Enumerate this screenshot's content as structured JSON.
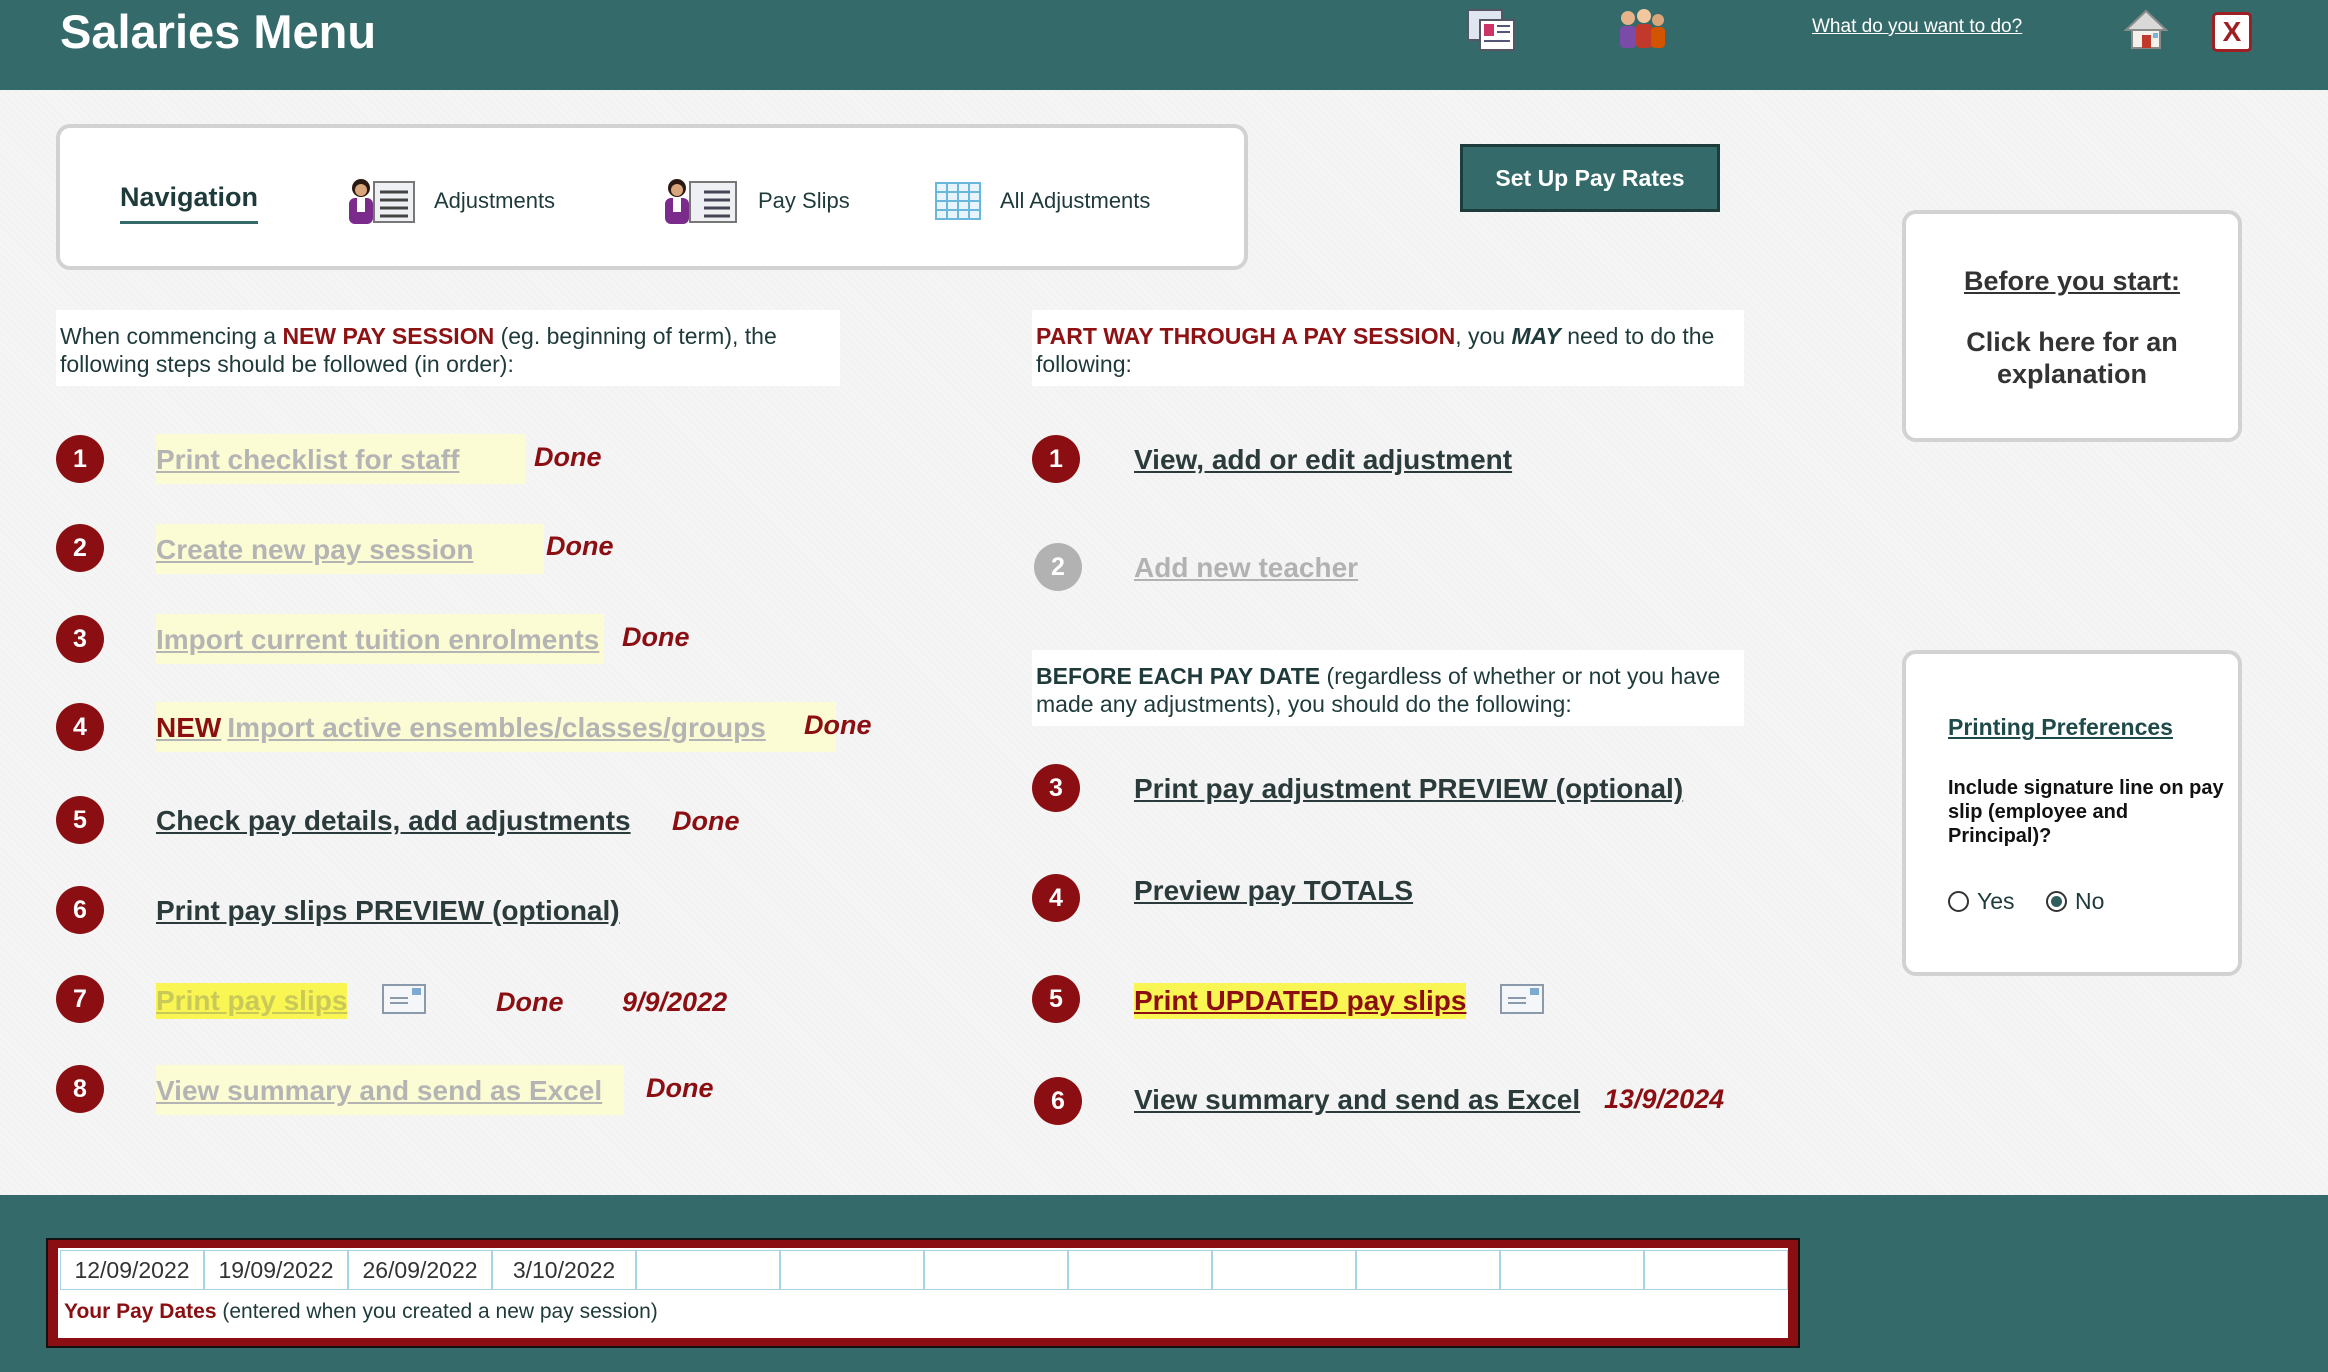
{
  "header": {
    "title": "Salaries Menu",
    "help_link": "What do you want to do?",
    "close_label": "X",
    "icons": [
      "documents-icon",
      "people-icon",
      "home-icon",
      "close-icon"
    ]
  },
  "navigation": {
    "title": "Navigation",
    "items": [
      {
        "label": "Adjustments",
        "icon": "person-list-icon"
      },
      {
        "label": "Pay Slips",
        "icon": "person-list-icon"
      },
      {
        "label": "All Adjustments",
        "icon": "grid-icon"
      }
    ]
  },
  "setup_button": "Set Up Pay Rates",
  "left_intro": {
    "part1": "When commencing a ",
    "bold": "NEW PAY SESSION",
    "part2": " (eg. beginning of term), the following steps should be followed (in order):"
  },
  "left_steps": [
    {
      "num": "1",
      "label": "Print checklist for staff",
      "status": "Done",
      "date": ""
    },
    {
      "num": "2",
      "label": "Create new pay session",
      "status": "Done",
      "date": ""
    },
    {
      "num": "3",
      "label": "Import current tuition enrolments",
      "status": "Done",
      "date": ""
    },
    {
      "num": "4",
      "new_tag": "NEW",
      "label": "Import active ensembles/classes/groups",
      "status": "Done",
      "date": ""
    },
    {
      "num": "5",
      "label": "Check pay details, add adjustments",
      "status": "Done",
      "date": ""
    },
    {
      "num": "6",
      "label": "Print pay slips PREVIEW (optional)",
      "status": "",
      "date": ""
    },
    {
      "num": "7",
      "label": "Print pay slips",
      "status": "Done",
      "date": "9/9/2022"
    },
    {
      "num": "8",
      "label": "View summary and send as Excel",
      "status": "Done",
      "date": ""
    }
  ],
  "right_intro": {
    "bold": "PART WAY THROUGH A PAY SESSION",
    "part1": ", you ",
    "may": "MAY",
    "part2": " need to do the following:"
  },
  "right_steps_a": [
    {
      "num": "1",
      "label": "View, add or edit adjustment"
    },
    {
      "num": "2",
      "label": "Add new teacher"
    }
  ],
  "before_each": {
    "bold": "BEFORE EACH PAY DATE",
    "rest": " (regardless of whether or not you have made any adjustments), you should do the following:"
  },
  "right_steps_b": [
    {
      "num": "3",
      "label": "Print pay adjustment PREVIEW (optional)",
      "date": ""
    },
    {
      "num": "4",
      "label": "Preview pay TOTALS",
      "date": ""
    },
    {
      "num": "5",
      "label": "Print UPDATED pay slips",
      "date": ""
    },
    {
      "num": "6",
      "label": "View summary and send as Excel",
      "date": "13/9/2024"
    }
  ],
  "before_start": {
    "title": "Before you start:",
    "line1": "Click here for an",
    "line2": "explanation"
  },
  "printing_prefs": {
    "title": "Printing Preferences",
    "question": "Include signature line on pay slip (employee and Principal)?",
    "options": [
      "Yes",
      "No"
    ],
    "selected": "No"
  },
  "pay_dates": {
    "dates": [
      "12/09/2022",
      "19/09/2022",
      "26/09/2022",
      "3/10/2022",
      "",
      "",
      "",
      "",
      "",
      "",
      "",
      ""
    ],
    "caption_bold": "Your Pay Dates",
    "caption_rest": " (entered when you created a new pay session)"
  },
  "colors": {
    "header": "#346b6a",
    "accent_red": "#8b0f12",
    "highlight_yellow": "#f9f553",
    "dim_highlight": "#fbfbd4"
  }
}
